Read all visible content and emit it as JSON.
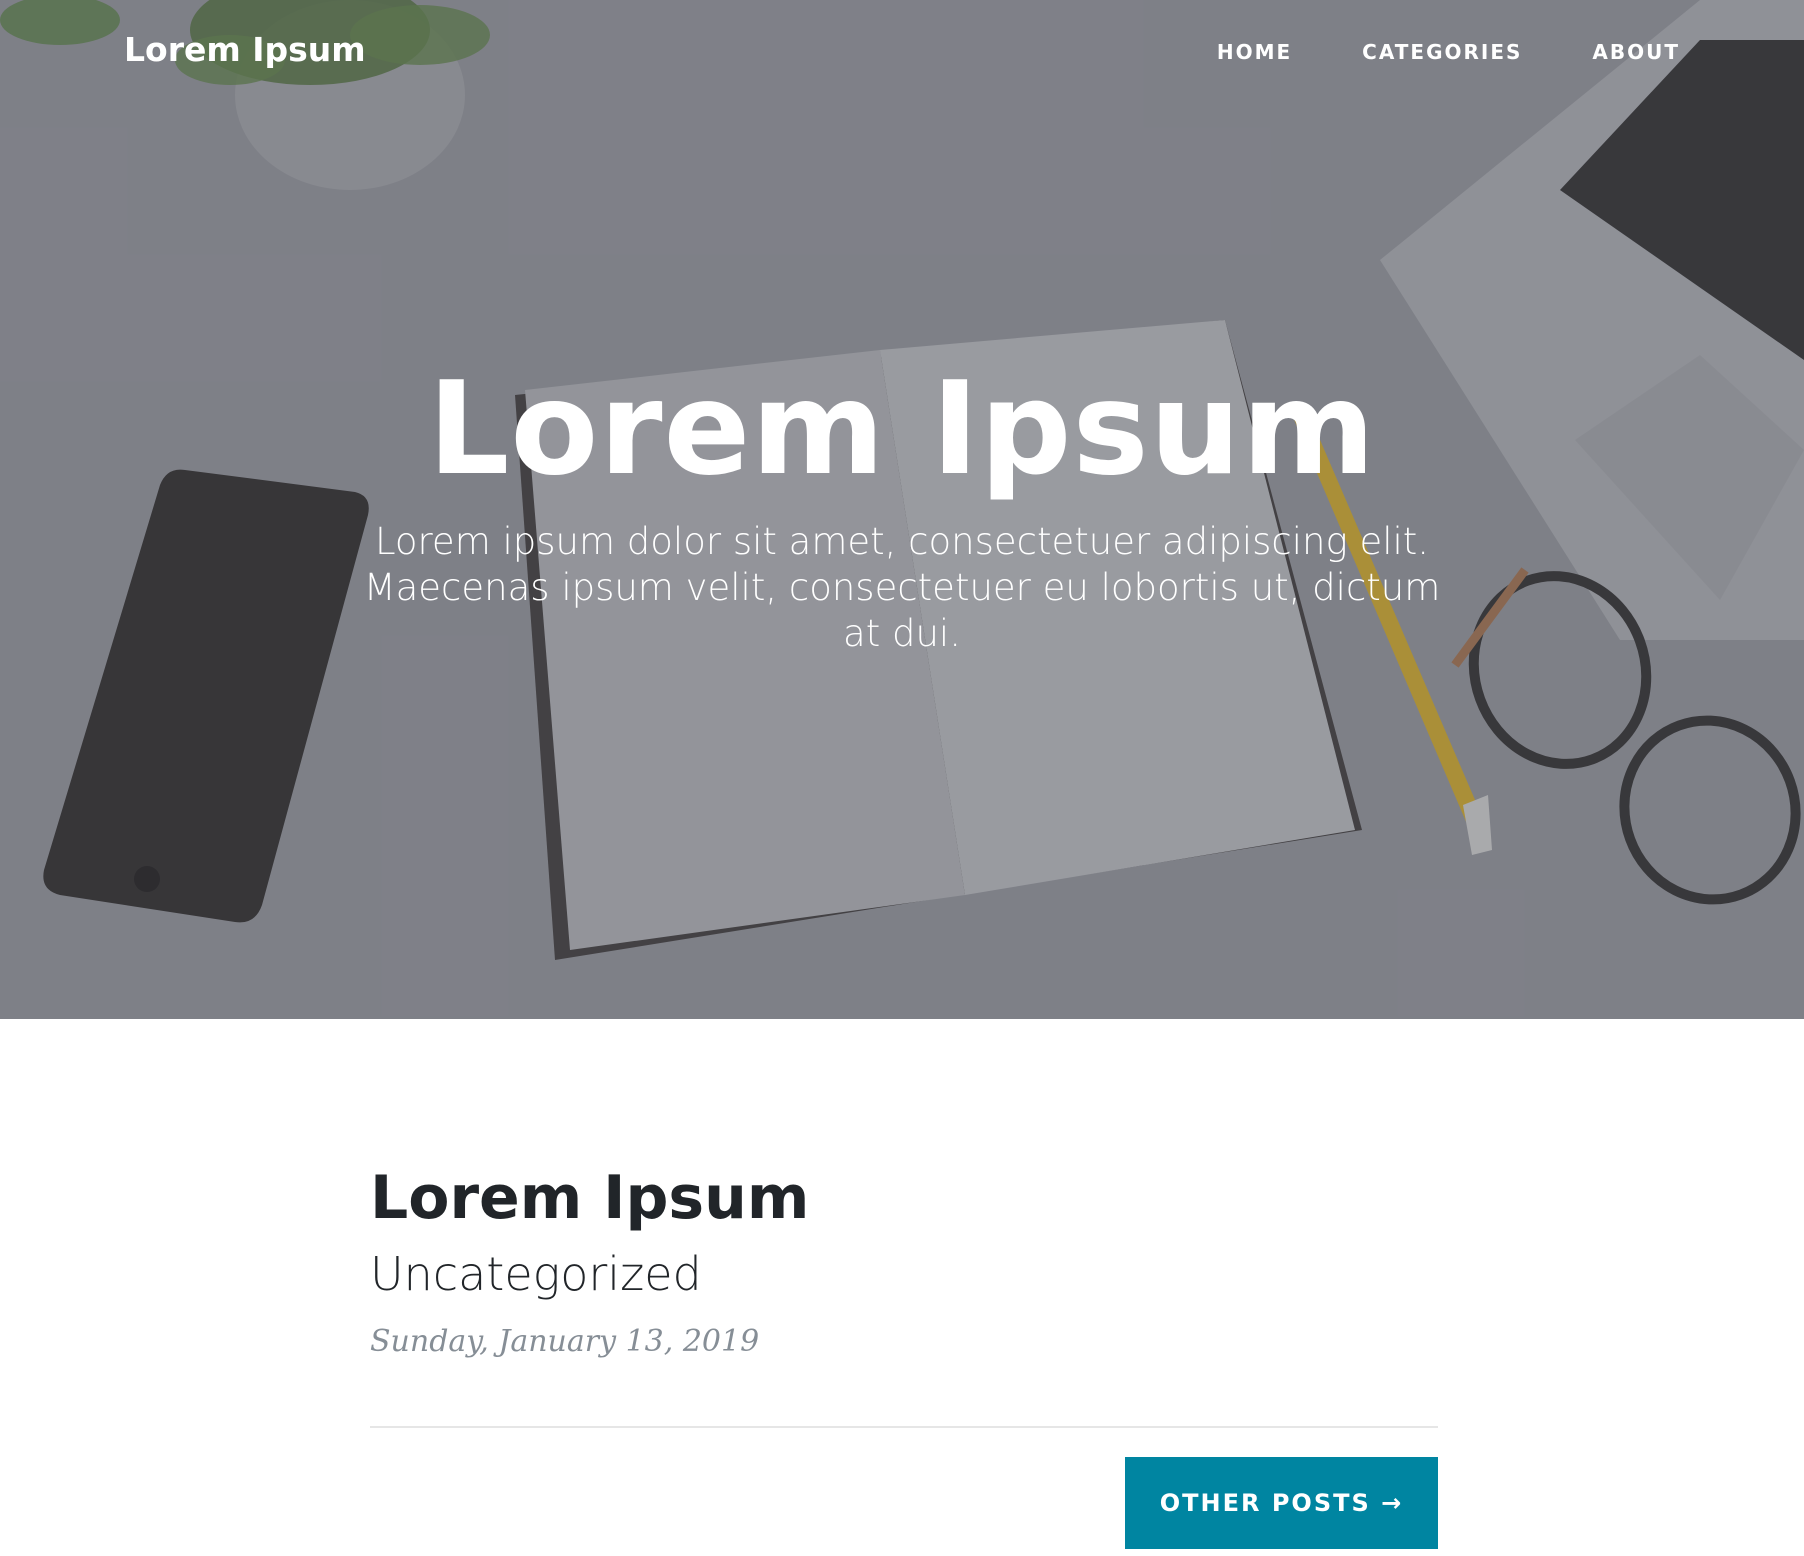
{
  "navbar": {
    "brand": "Lorem Ipsum",
    "links": [
      "HOME",
      "CATEGORIES",
      "ABOUT"
    ]
  },
  "hero": {
    "title": "Lorem Ipsum",
    "subtitle": "Lorem ipsum dolor sit amet, consectetuer adipiscing elit. Maecenas ipsum velit, consectetuer eu lobortis ut, dictum at dui."
  },
  "post": {
    "title": "Lorem Ipsum",
    "category": "Uncategorized",
    "date": "Sunday, January 13, 2019"
  },
  "pager": {
    "other_posts_label": "OTHER POSTS →"
  },
  "colors": {
    "accent": "#0085a1",
    "heading": "#212529",
    "muted": "#868e96",
    "hero_overlay": "#84858c"
  }
}
